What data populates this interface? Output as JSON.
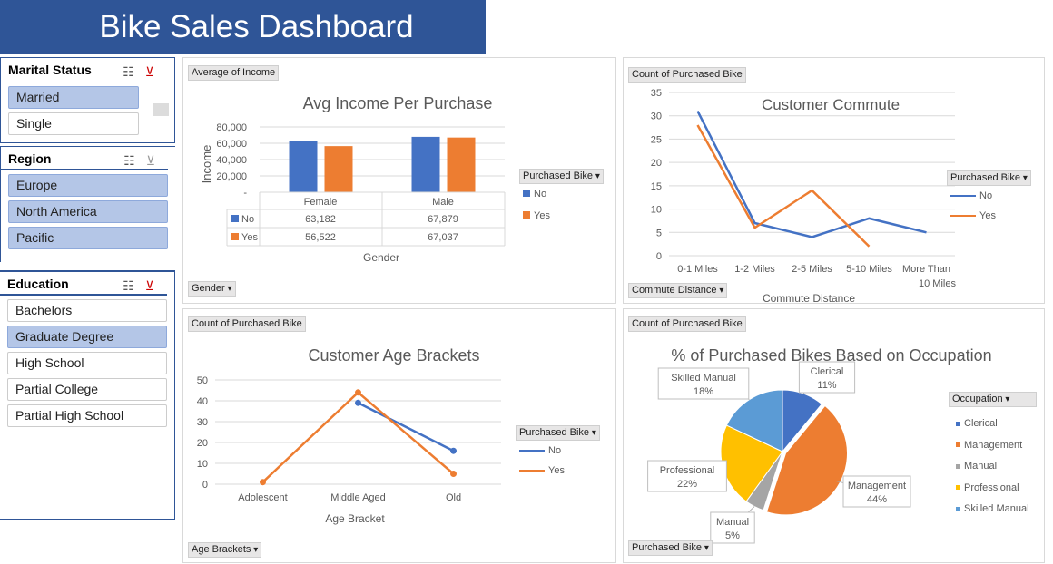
{
  "dashboard": {
    "title": "Bike Sales Dashboard"
  },
  "slicers": {
    "marital": {
      "title": "Marital Status",
      "items": [
        {
          "label": "Married",
          "selected": true
        },
        {
          "label": "Single",
          "selected": false
        }
      ]
    },
    "region": {
      "title": "Region",
      "items": [
        {
          "label": "Europe",
          "selected": true
        },
        {
          "label": "North America",
          "selected": true
        },
        {
          "label": "Pacific",
          "selected": true
        }
      ]
    },
    "education": {
      "title": "Education",
      "items": [
        {
          "label": "Bachelors",
          "selected": false
        },
        {
          "label": "Graduate Degree",
          "selected": true
        },
        {
          "label": "High School",
          "selected": false
        },
        {
          "label": "Partial College",
          "selected": false
        },
        {
          "label": "Partial High School",
          "selected": false
        }
      ]
    },
    "icons": {
      "multiselect": "multi-select-icon",
      "clear": "clear-filter-icon"
    }
  },
  "income_panel": {
    "value_field": "Average of Income",
    "axis_field": "Gender",
    "legend_field": "Purchased Bike",
    "table_no": "No",
    "table_yes": "Yes",
    "no_female": "63,182",
    "no_male": "67,879",
    "yes_female": "56,522",
    "yes_male": "67,037"
  },
  "commute_panel": {
    "value_field": "Count of Purchased Bike",
    "axis_field": "Commute Distance",
    "legend_field": "Purchased Bike"
  },
  "age_panel": {
    "value_field": "Count of Purchased Bike",
    "axis_field": "Age Brackets",
    "legend_field": "Purchased Bike"
  },
  "occupation_panel": {
    "value_field": "Count of Purchased Bike",
    "axis_field": "Purchased Bike",
    "legend_field": "Occupation"
  },
  "colors": {
    "no": "#4472c4",
    "yes": "#ed7d31",
    "header": "#2f5597",
    "selected": "#b4c6e7"
  },
  "chart_data": [
    {
      "type": "bar",
      "title": "Avg Income Per Purchase",
      "xlabel": "Gender",
      "ylabel": "Income",
      "categories": [
        "Female",
        "Male"
      ],
      "series": [
        {
          "name": "No",
          "values": [
            63182,
            67879
          ]
        },
        {
          "name": "Yes",
          "values": [
            56522,
            67037
          ]
        }
      ],
      "yticks": [
        "-",
        "20,000",
        "40,000",
        "60,000",
        "80,000"
      ],
      "ylim": [
        0,
        80000
      ]
    },
    {
      "type": "line",
      "title": "Customer Commute",
      "xlabel": "Commute Distance",
      "categories": [
        "0-1 Miles",
        "1-2 Miles",
        "2-5 Miles",
        "5-10 Miles",
        "More Than 10 Miles"
      ],
      "series": [
        {
          "name": "No",
          "values": [
            31,
            7,
            4,
            8,
            5
          ]
        },
        {
          "name": "Yes",
          "values": [
            28,
            6,
            14,
            2,
            null
          ]
        }
      ],
      "yticks": [
        "0",
        "5",
        "10",
        "15",
        "20",
        "25",
        "30",
        "35"
      ],
      "ylim": [
        0,
        35
      ],
      "grid": true,
      "legend": "right"
    },
    {
      "type": "line",
      "title": "Customer Age Brackets",
      "xlabel": "Age Bracket",
      "categories": [
        "Adolescent",
        "Middle Aged",
        "Old"
      ],
      "series": [
        {
          "name": "No",
          "values": [
            null,
            39,
            16
          ]
        },
        {
          "name": "Yes",
          "values": [
            1,
            44,
            5
          ]
        }
      ],
      "yticks": [
        "0",
        "10",
        "20",
        "30",
        "40",
        "50"
      ],
      "ylim": [
        0,
        50
      ],
      "grid": true,
      "legend": "right"
    },
    {
      "type": "pie",
      "title": "% of Purchased Bikes Based on Occupation",
      "categories": [
        "Clerical",
        "Management",
        "Manual",
        "Professional",
        "Skilled Manual"
      ],
      "values": [
        11,
        44,
        5,
        22,
        18
      ],
      "labels": [
        "11%",
        "44%",
        "5%",
        "22%",
        "18%"
      ],
      "colors": [
        "#4472c4",
        "#ed7d31",
        "#a5a5a5",
        "#ffc000",
        "#5b9bd5"
      ],
      "legend": "right"
    }
  ]
}
